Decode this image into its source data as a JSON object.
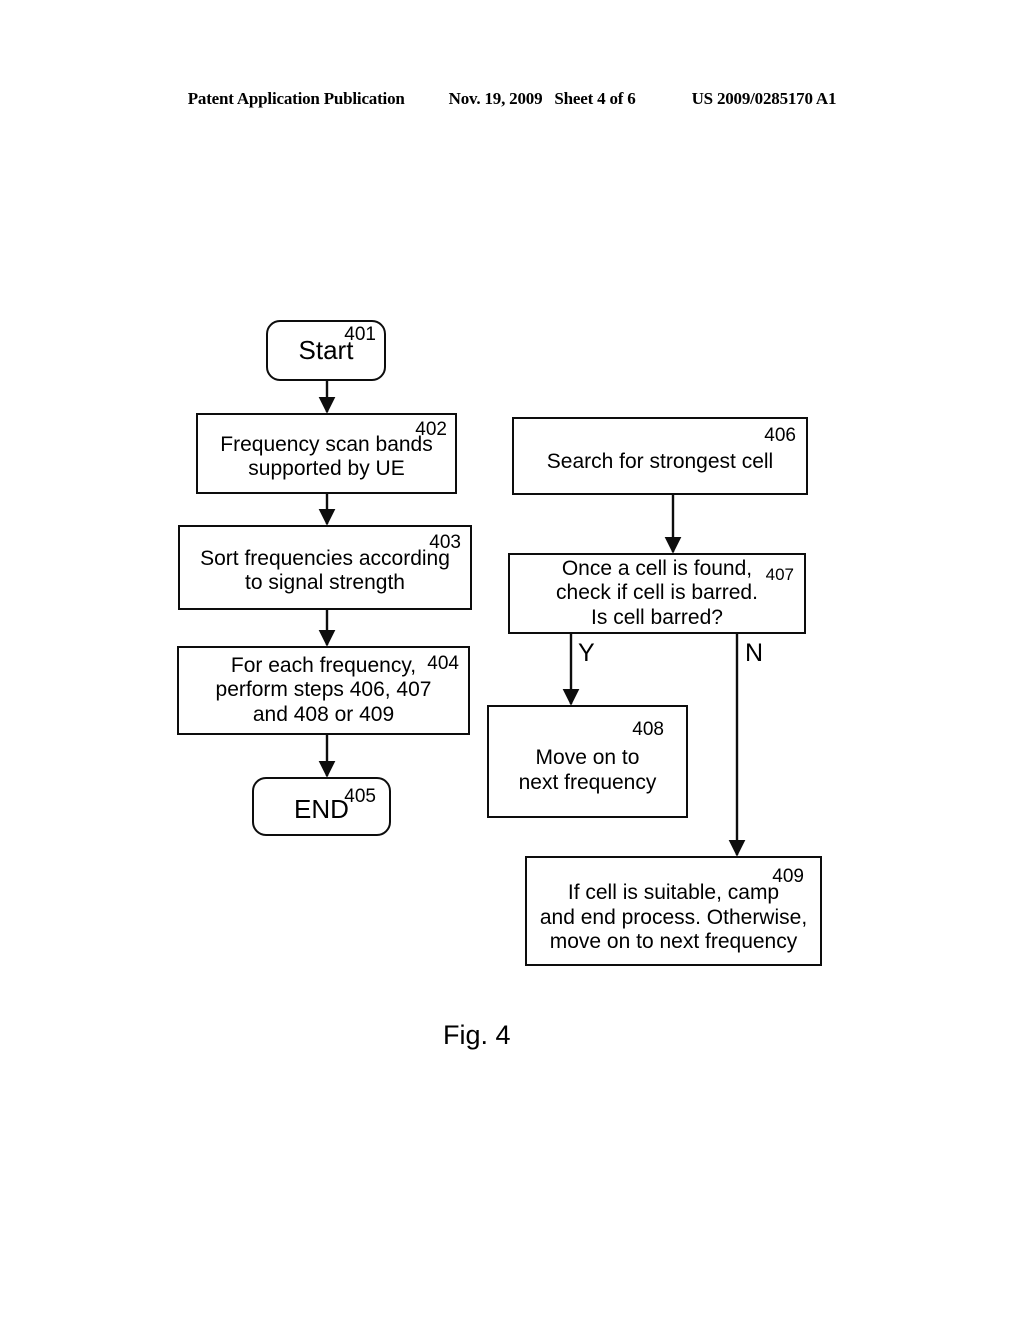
{
  "header": {
    "publication": "Patent Application Publication",
    "date": "Nov. 19, 2009",
    "sheet": "Sheet 4 of 6",
    "patent_number": "US 2009/0285170 A1"
  },
  "figure": {
    "caption": "Fig. 4",
    "line_color": "#0d0d0d",
    "background": "#ffffff",
    "nodes": [
      {
        "id": "401",
        "ref": "401",
        "shape": "rounded",
        "text": "Start"
      },
      {
        "id": "402",
        "ref": "402",
        "shape": "rect",
        "text": "Frequency scan bands\nsupported by UE"
      },
      {
        "id": "403",
        "ref": "403",
        "shape": "rect",
        "text": "Sort frequencies according\nto signal strength"
      },
      {
        "id": "404",
        "ref": "404",
        "shape": "rect",
        "text": "For each frequency,\nperform steps 406, 407\nand 408 or 409"
      },
      {
        "id": "405",
        "ref": "405",
        "shape": "rounded",
        "text": "END"
      },
      {
        "id": "406",
        "ref": "406",
        "shape": "rect",
        "text": "Search for strongest cell"
      },
      {
        "id": "407",
        "ref": "407",
        "shape": "rect",
        "text": "Once a cell is found,\ncheck if cell is barred.\nIs cell barred?"
      },
      {
        "id": "408",
        "ref": "408",
        "shape": "rect",
        "text": "Move on to\nnext frequency"
      },
      {
        "id": "409",
        "ref": "409",
        "shape": "rect",
        "text": "If cell is suitable, camp\nand end process.  Otherwise,\nmove on to next frequency"
      }
    ],
    "branches": [
      {
        "id": "yes",
        "label": "Y",
        "from": "407",
        "to": "408"
      },
      {
        "id": "no",
        "label": "N",
        "from": "407",
        "to": "409"
      }
    ],
    "edges": [
      {
        "from": "401",
        "to": "402"
      },
      {
        "from": "402",
        "to": "403"
      },
      {
        "from": "403",
        "to": "404"
      },
      {
        "from": "404",
        "to": "405"
      },
      {
        "from": "406",
        "to": "407"
      }
    ]
  }
}
